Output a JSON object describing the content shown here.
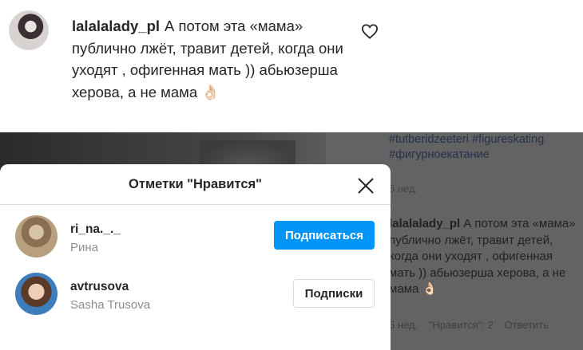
{
  "top_comment": {
    "username": "lalalalady_pl",
    "text": "А потом эта «мама» публично лжёт, травит детей, когда они уходят , офигенная мать )) абьюзерша херова, а не мама",
    "emoji": "👌🏻"
  },
  "background": {
    "hashtags": "#tutberidzeeteri #figureskating #фигурноекатание",
    "hashtags_time": "5 нед.",
    "comment_username": "lalalalady_pl",
    "comment_text": "А потом эта «мама» публично лжёт, травит детей, когда они уходят , офигенная мать )) абьюзерша херова, а не мама",
    "comment_emoji": "👌🏻",
    "meta_time": "5 нед.",
    "meta_likes": "\"Нравится\": 2",
    "meta_reply": "Ответить"
  },
  "likes_modal": {
    "title": "Отметки \"Нравится\"",
    "users": [
      {
        "username": "ri_na._._",
        "fullname": "Рина",
        "button": "Подписаться"
      },
      {
        "username": "avtrusova",
        "fullname": "Sasha Trusova",
        "button": "Подписки"
      }
    ]
  },
  "colors": {
    "follow_blue": "#0095f6",
    "secondary_text": "#8e8e8e",
    "border": "#dbdbdb"
  },
  "icons": [
    "heart-icon",
    "close-icon"
  ]
}
